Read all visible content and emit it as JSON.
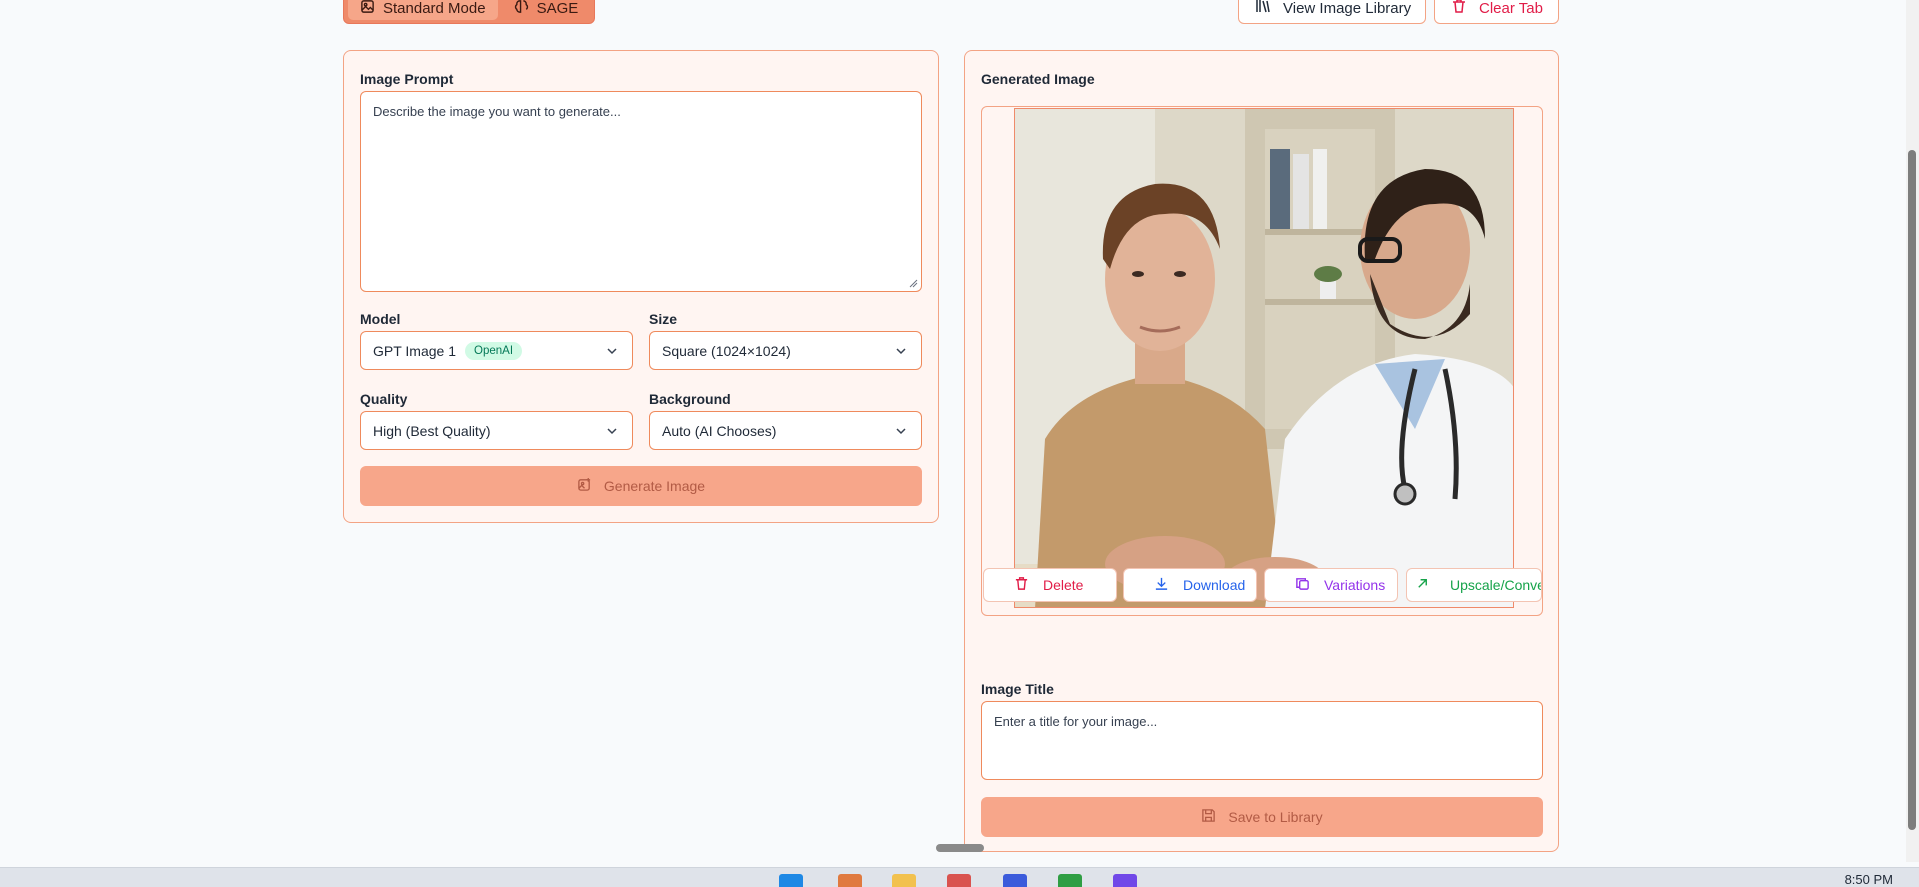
{
  "modes": {
    "standard_label": "Standard Mode",
    "sage_label": "SAGE",
    "standard_icon": "image-icon",
    "sage_icon": "brain-icon"
  },
  "toolbar": {
    "library_label": "View Image Library",
    "clear_label": "Clear Tab",
    "library_icon": "library-icon",
    "clear_icon": "trash-icon"
  },
  "prompt": {
    "label": "Image Prompt",
    "placeholder": "Describe the image you want to generate..."
  },
  "model": {
    "label": "Model",
    "value": "GPT Image 1",
    "badge": "OpenAI"
  },
  "size": {
    "label": "Size",
    "value": "Square (1024×1024)"
  },
  "quality": {
    "label": "Quality",
    "value": "High (Best Quality)"
  },
  "background": {
    "label": "Background",
    "value": "Auto (AI Chooses)"
  },
  "generate": {
    "label": "Generate Image",
    "icon": "image-plus-icon"
  },
  "generated": {
    "title": "Generated Image",
    "image_alt": "man-and-doctor-consultation-photo"
  },
  "actions": {
    "delete": "Delete",
    "download": "Download",
    "variations": "Variations",
    "upscale": "Upscale/Convert"
  },
  "image_title": {
    "label": "Image Title",
    "placeholder": "Enter a title for your image..."
  },
  "save": {
    "label": "Save to Library",
    "icon": "save-icon"
  },
  "taskbar": {
    "time": "8:50 PM"
  },
  "colors": {
    "accent": "#ef8a5c",
    "card_bg": "#fff5f2",
    "cta_bg": "#f7a68a",
    "delete": "#e11d48",
    "download": "#2563eb",
    "variations": "#9333ea",
    "upscale": "#16a34a"
  }
}
